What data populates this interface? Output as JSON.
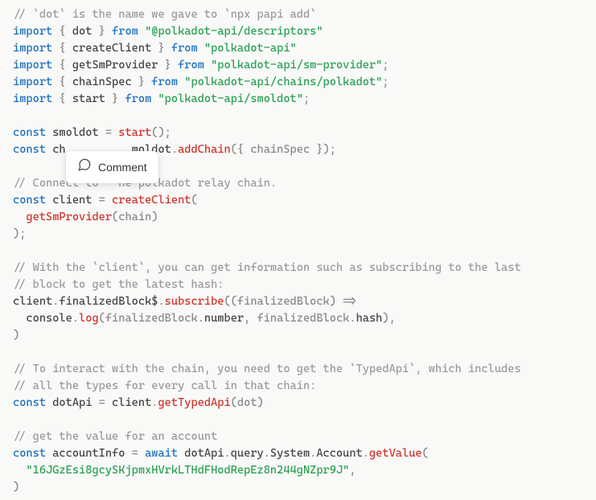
{
  "tooltip": {
    "label": "Comment"
  },
  "code": {
    "l1_comment": "// `dot` is the name we gave to `npx papi add`",
    "l2_import": "import",
    "l2_brace_o": " { ",
    "l2_ident": "dot",
    "l2_brace_c": " } ",
    "l2_from": "from",
    "l2_sp": " ",
    "l2_str": "\"@polkadot-api/descriptors\"",
    "l3_import": "import",
    "l3_brace_o": " { ",
    "l3_ident": "createClient",
    "l3_brace_c": " } ",
    "l3_from": "from",
    "l3_sp": " ",
    "l3_str": "\"polkadot-api\"",
    "l4_import": "import",
    "l4_brace_o": " { ",
    "l4_ident": "getSmProvider",
    "l4_brace_c": " } ",
    "l4_from": "from",
    "l4_sp": " ",
    "l4_str": "\"polkadot-api/sm-provider\"",
    "l4_semi": ";",
    "l5_import": "import",
    "l5_brace_o": " { ",
    "l5_ident": "chainSpec",
    "l5_brace_c": " } ",
    "l5_from": "from",
    "l5_sp": " ",
    "l5_str": "\"polkadot-api/chains/polkadot\"",
    "l5_semi": ";",
    "l6_import": "import",
    "l6_brace_o": " { ",
    "l6_ident": "start",
    "l6_brace_c": " } ",
    "l6_from": "from",
    "l6_sp": " ",
    "l6_str": "\"polkadot-api/smoldot\"",
    "l6_semi": ";",
    "l8_const": "const",
    "l8_sp1": " ",
    "l8_name": "smoldot",
    "l8_sp2": " ",
    "l8_eq": "=",
    "l8_sp3": " ",
    "l8_fn": "start",
    "l8_paren": "();",
    "l9_const": "const",
    "l9_sp1": " ",
    "l9_name": "ch",
    "l9_gap": "          ",
    "l9_ident": "moldot",
    "l9_dot": ".",
    "l9_fn": "addChain",
    "l9_args": "({ chainSpec });",
    "l11_comment_a": "// Conne",
    "l11_comment_b": "ct to",
    "l11_comment_c": "   he polkadot relay chain.",
    "l12_const": "const",
    "l12_sp1": " ",
    "l12_name": "client",
    "l12_sp2": " ",
    "l12_eq": "=",
    "l12_sp3": " ",
    "l12_fn": "createClient",
    "l12_paren": "(",
    "l13_indent": "  ",
    "l13_fn": "getSmProvider",
    "l13_args": "(chain)",
    "l14": ");",
    "l16_comment": "// With the `client`, you can get information such as subscribing to the last",
    "l17_comment": "// block to get the latest hash:",
    "l18_a": "client",
    "l18_d1": ".",
    "l18_b": "finalizedBlock$",
    "l18_d2": ".",
    "l18_fn": "subscribe",
    "l18_args": "((finalizedBlock) =>",
    "l19_indent": "  ",
    "l19_a": "console",
    "l19_d1": ".",
    "l19_fn": "log",
    "l19_p1": "(finalizedBlock",
    "l19_d2": ".",
    "l19_num": "number",
    "l19_c": ", finalizedBlock",
    "l19_d3": ".",
    "l19_hash": "hash",
    "l19_p2": "),",
    "l20": ")",
    "l22_comment": "// To interact with the chain, you need to get the `TypedApi`, which includes",
    "l23_comment": "// all the types for every call in that chain:",
    "l24_const": "const",
    "l24_sp1": " ",
    "l24_name": "dotApi",
    "l24_sp2": " ",
    "l24_eq": "=",
    "l24_sp3": " ",
    "l24_a": "client",
    "l24_d1": ".",
    "l24_fn": "getTypedApi",
    "l24_args": "(dot)",
    "l26_comment": "// get the value for an account",
    "l27_const": "const",
    "l27_sp1": " ",
    "l27_name": "accountInfo",
    "l27_sp2": " ",
    "l27_eq": "=",
    "l27_sp3": " ",
    "l27_await": "await",
    "l27_sp4": " ",
    "l27_a": "dotApi",
    "l27_d1": ".",
    "l27_b": "query",
    "l27_d2": ".",
    "l27_c": "System",
    "l27_d3": ".",
    "l27_d": "Account",
    "l27_d4": ".",
    "l27_fn": "getValue",
    "l27_p": "(",
    "l28_indent": "  ",
    "l28_str": "\"16JGzEsi8gcySKjpmxHVrkLTHdFHodRepEz8n244gNZpr9J\"",
    "l28_c": ",",
    "l29": ")"
  }
}
